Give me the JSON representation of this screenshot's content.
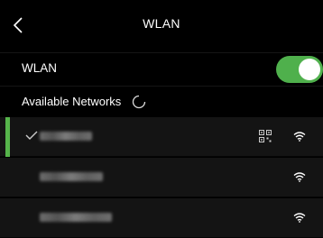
{
  "header": {
    "title": "WLAN",
    "back_icon": "chevron-left-icon"
  },
  "wlan": {
    "label": "WLAN",
    "enabled": true,
    "toggle_color": "#4fb04c"
  },
  "available": {
    "label": "Available Networks",
    "loading_icon": "spinner-icon"
  },
  "networks": [
    {
      "connected": true,
      "icons": [
        "check-icon",
        "qr-code-icon",
        "wifi-signal-icon"
      ]
    },
    {
      "connected": false,
      "icons": [
        "wifi-signal-icon"
      ]
    },
    {
      "connected": false,
      "icons": [
        "wifi-signal-icon"
      ]
    }
  ],
  "colors": {
    "accent": "#56b44b",
    "background": "#000000",
    "row": "#141414"
  }
}
